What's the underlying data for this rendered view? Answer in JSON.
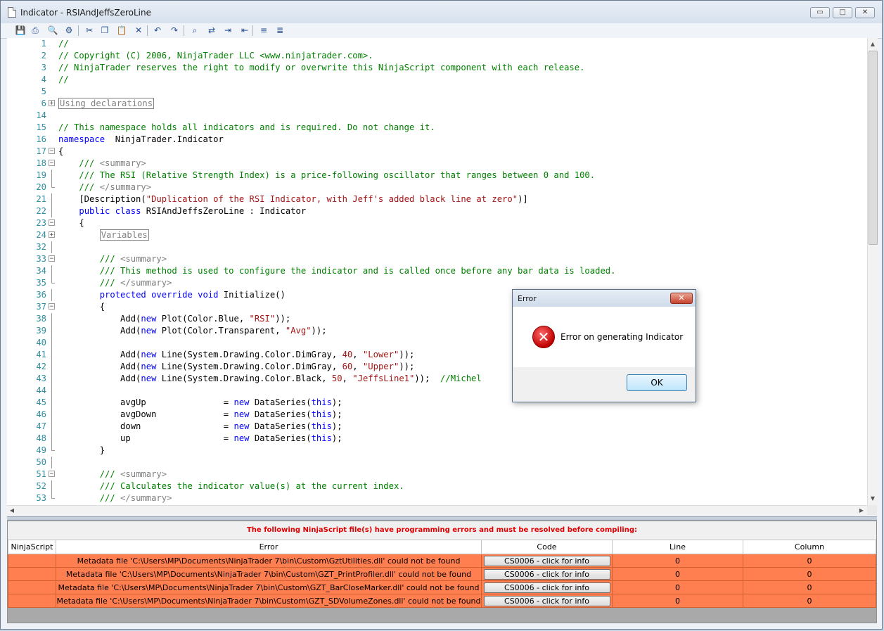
{
  "window": {
    "title": "Indicator - RSIAndJeffsZeroLine",
    "controls": {
      "minimize": "▭",
      "maximize": "□",
      "close": "✕"
    }
  },
  "toolbar": {
    "icons": [
      "save-icon",
      "print-icon",
      "print-preview-icon",
      "page-setup-icon",
      "cut-icon",
      "copy-icon",
      "paste-icon",
      "delete-icon",
      "undo-icon",
      "redo-icon",
      "find-icon",
      "find-replace-icon",
      "indent-icon",
      "outdent-icon",
      "comment-icon",
      "uncomment-icon"
    ]
  },
  "editor": {
    "lines": [
      {
        "n": "1",
        "fold": "",
        "code": [
          [
            "c-comment",
            "//"
          ]
        ]
      },
      {
        "n": "2",
        "fold": "",
        "code": [
          [
            "c-comment",
            "// Copyright (C) 2006, NinjaTrader LLC <www.ninjatrader.com>."
          ]
        ]
      },
      {
        "n": "3",
        "fold": "",
        "code": [
          [
            "c-comment",
            "// NinjaTrader reserves the right to modify or overwrite this NinjaScript component with each release."
          ]
        ]
      },
      {
        "n": "4",
        "fold": "",
        "code": [
          [
            "c-comment",
            "//"
          ]
        ]
      },
      {
        "n": "5",
        "fold": "",
        "code": []
      },
      {
        "n": "6",
        "fold": "plus",
        "code": [
          [
            "c-region",
            "Using declarations"
          ]
        ]
      },
      {
        "n": "14",
        "fold": "",
        "code": []
      },
      {
        "n": "15",
        "fold": "",
        "code": [
          [
            "c-comment",
            "// This namespace holds all indicators and is required. Do not change it."
          ]
        ]
      },
      {
        "n": "16",
        "fold": "",
        "code": [
          [
            "c-kw",
            "namespace"
          ],
          [
            "",
            "  NinjaTrader.Indicator"
          ]
        ]
      },
      {
        "n": "17",
        "fold": "minus",
        "code": [
          [
            "",
            "{"
          ]
        ]
      },
      {
        "n": "18",
        "fold": "minus",
        "code": [
          [
            "",
            "    "
          ],
          [
            "c-comment",
            "/// "
          ],
          [
            "c-doc",
            "<summary>"
          ]
        ]
      },
      {
        "n": "19",
        "fold": "line",
        "code": [
          [
            "",
            "    "
          ],
          [
            "c-comment",
            "/// The RSI (Relative Strength Index) is a price-following oscillator that ranges between 0 and 100."
          ]
        ]
      },
      {
        "n": "20",
        "fold": "end",
        "code": [
          [
            "",
            "    "
          ],
          [
            "c-comment",
            "/// "
          ],
          [
            "c-doc",
            "</summary>"
          ]
        ]
      },
      {
        "n": "21",
        "fold": "line",
        "code": [
          [
            "",
            "    [Description("
          ],
          [
            "c-str",
            "\"Duplication of the RSI Indicator, with Jeff's added black line at zero\""
          ],
          [
            "",
            ")]"
          ]
        ]
      },
      {
        "n": "22",
        "fold": "line",
        "code": [
          [
            "",
            "    "
          ],
          [
            "c-kw",
            "public class"
          ],
          [
            "",
            " RSIAndJeffsZeroLine : Indicator"
          ]
        ]
      },
      {
        "n": "23",
        "fold": "minus",
        "code": [
          [
            "",
            "    {"
          ]
        ]
      },
      {
        "n": "24",
        "fold": "plus",
        "code": [
          [
            "",
            "        "
          ],
          [
            "c-region",
            "Variables"
          ]
        ]
      },
      {
        "n": "32",
        "fold": "line",
        "code": []
      },
      {
        "n": "33",
        "fold": "minus",
        "code": [
          [
            "",
            "        "
          ],
          [
            "c-comment",
            "/// "
          ],
          [
            "c-doc",
            "<summary>"
          ]
        ]
      },
      {
        "n": "34",
        "fold": "line",
        "code": [
          [
            "",
            "        "
          ],
          [
            "c-comment",
            "/// This method is used to configure the indicator and is called once before any bar data is loaded."
          ]
        ]
      },
      {
        "n": "35",
        "fold": "end",
        "code": [
          [
            "",
            "        "
          ],
          [
            "c-comment",
            "/// "
          ],
          [
            "c-doc",
            "</summary>"
          ]
        ]
      },
      {
        "n": "36",
        "fold": "line",
        "code": [
          [
            "",
            "        "
          ],
          [
            "c-kw",
            "protected override void"
          ],
          [
            "",
            " Initialize()"
          ]
        ]
      },
      {
        "n": "37",
        "fold": "minus",
        "code": [
          [
            "",
            "        {"
          ]
        ]
      },
      {
        "n": "38",
        "fold": "line",
        "code": [
          [
            "",
            "            Add("
          ],
          [
            "c-kw",
            "new"
          ],
          [
            "",
            " Plot(Color.Blue, "
          ],
          [
            "c-str",
            "\"RSI\""
          ],
          [
            "",
            "));"
          ]
        ]
      },
      {
        "n": "39",
        "fold": "line",
        "code": [
          [
            "",
            "            Add("
          ],
          [
            "c-kw",
            "new"
          ],
          [
            "",
            " Plot(Color.Transparent, "
          ],
          [
            "c-str",
            "\"Avg\""
          ],
          [
            "",
            "));"
          ]
        ]
      },
      {
        "n": "40",
        "fold": "line",
        "code": []
      },
      {
        "n": "41",
        "fold": "line",
        "code": [
          [
            "",
            "            Add("
          ],
          [
            "c-kw",
            "new"
          ],
          [
            "",
            " Line(System.Drawing.Color.DimGray, "
          ],
          [
            "c-str",
            "40"
          ],
          [
            "",
            ", "
          ],
          [
            "c-str",
            "\"Lower\""
          ],
          [
            "",
            "));"
          ]
        ]
      },
      {
        "n": "42",
        "fold": "line",
        "code": [
          [
            "",
            "            Add("
          ],
          [
            "c-kw",
            "new"
          ],
          [
            "",
            " Line(System.Drawing.Color.DimGray, "
          ],
          [
            "c-str",
            "60"
          ],
          [
            "",
            ", "
          ],
          [
            "c-str",
            "\"Upper\""
          ],
          [
            "",
            "));"
          ]
        ]
      },
      {
        "n": "43",
        "fold": "line",
        "code": [
          [
            "",
            "            Add("
          ],
          [
            "c-kw",
            "new"
          ],
          [
            "",
            " Line(System.Drawing.Color.Black, "
          ],
          [
            "c-str",
            "50"
          ],
          [
            "",
            ", "
          ],
          [
            "c-str",
            "\"JeffsLine1\""
          ],
          [
            "",
            "));  "
          ],
          [
            "c-comment",
            "//Michel"
          ]
        ]
      },
      {
        "n": "44",
        "fold": "line",
        "code": []
      },
      {
        "n": "45",
        "fold": "line",
        "code": [
          [
            "",
            "            avgUp               = "
          ],
          [
            "c-kw",
            "new"
          ],
          [
            "",
            " DataSeries("
          ],
          [
            "c-kw",
            "this"
          ],
          [
            "",
            ");"
          ]
        ]
      },
      {
        "n": "46",
        "fold": "line",
        "code": [
          [
            "",
            "            avgDown             = "
          ],
          [
            "c-kw",
            "new"
          ],
          [
            "",
            " DataSeries("
          ],
          [
            "c-kw",
            "this"
          ],
          [
            "",
            ");"
          ]
        ]
      },
      {
        "n": "47",
        "fold": "line",
        "code": [
          [
            "",
            "            down                = "
          ],
          [
            "c-kw",
            "new"
          ],
          [
            "",
            " DataSeries("
          ],
          [
            "c-kw",
            "this"
          ],
          [
            "",
            ");"
          ]
        ]
      },
      {
        "n": "48",
        "fold": "line",
        "code": [
          [
            "",
            "            up                  = "
          ],
          [
            "c-kw",
            "new"
          ],
          [
            "",
            " DataSeries("
          ],
          [
            "c-kw",
            "this"
          ],
          [
            "",
            ");"
          ]
        ]
      },
      {
        "n": "49",
        "fold": "end",
        "code": [
          [
            "",
            "        }"
          ]
        ]
      },
      {
        "n": "50",
        "fold": "line",
        "code": []
      },
      {
        "n": "51",
        "fold": "minus",
        "code": [
          [
            "",
            "        "
          ],
          [
            "c-comment",
            "/// "
          ],
          [
            "c-doc",
            "<summary>"
          ]
        ]
      },
      {
        "n": "52",
        "fold": "line",
        "code": [
          [
            "",
            "        "
          ],
          [
            "c-comment",
            "/// Calculates the indicator value(s) at the current index."
          ]
        ]
      },
      {
        "n": "53",
        "fold": "end",
        "code": [
          [
            "",
            "        "
          ],
          [
            "c-comment",
            "/// "
          ],
          [
            "c-doc",
            "</summary>"
          ]
        ]
      }
    ]
  },
  "errors": {
    "header": "The following NinjaScript file(s) have programming errors and must be resolved before compiling:",
    "columns": [
      "NinjaScript",
      "Error",
      "Code",
      "Line",
      "Column"
    ],
    "rows": [
      {
        "script": "",
        "error": "Metadata file 'C:\\Users\\MP\\Documents\\NinjaTrader 7\\bin\\Custom\\GztUtilities.dll' could not be found",
        "code": "CS0006 - click for info",
        "line": "0",
        "column": "0"
      },
      {
        "script": "",
        "error": "Metadata file 'C:\\Users\\MP\\Documents\\NinjaTrader 7\\bin\\Custom\\GZT_PrintProfiler.dll' could not be found",
        "code": "CS0006 - click for info",
        "line": "0",
        "column": "0"
      },
      {
        "script": "",
        "error": "Metadata file 'C:\\Users\\MP\\Documents\\NinjaTrader 7\\bin\\Custom\\GZT_BarCloseMarker.dll' could not be found",
        "code": "CS0006 - click for info",
        "line": "0",
        "column": "0"
      },
      {
        "script": "",
        "error": "Metadata file 'C:\\Users\\MP\\Documents\\NinjaTrader 7\\bin\\Custom\\GZT_SDVolumeZones.dll' could not be found",
        "code": "CS0006 - click for info",
        "line": "0",
        "column": "0"
      }
    ]
  },
  "dialog": {
    "title": "Error",
    "close": "✕",
    "message": "Error on generating Indicator",
    "icon_glyph": "✕",
    "ok_label": "OK"
  }
}
